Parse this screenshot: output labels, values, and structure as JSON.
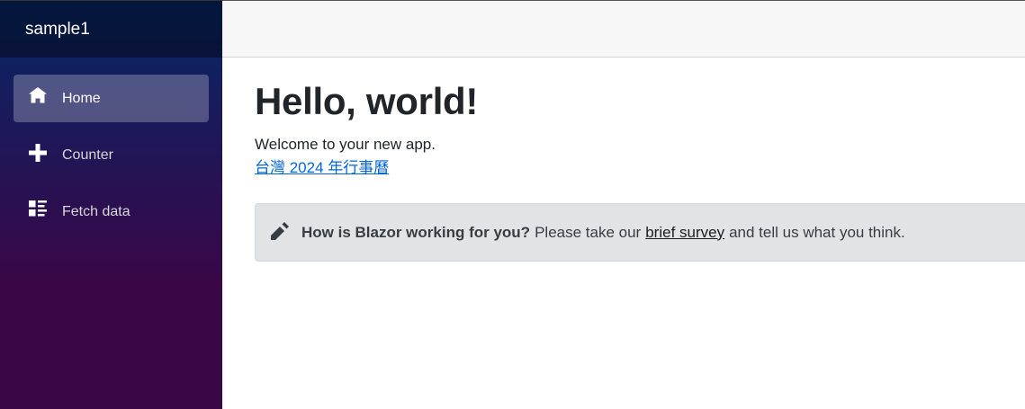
{
  "sidebar": {
    "brand": "sample1",
    "items": [
      {
        "label": "Home",
        "icon": "home-icon",
        "active": true
      },
      {
        "label": "Counter",
        "icon": "plus-icon",
        "active": false
      },
      {
        "label": "Fetch data",
        "icon": "list-rich-icon",
        "active": false
      }
    ]
  },
  "main": {
    "title": "Hello, world!",
    "welcome": "Welcome to your new app.",
    "link": "台灣 2024 年行事曆",
    "survey": {
      "bold": "How is Blazor working for you?",
      "before_link": "Please take our",
      "link": "brief survey",
      "after_link": "and tell us what you think."
    }
  },
  "colors": {
    "sidebar_top": "#052767",
    "sidebar_bottom": "#3a0647",
    "link": "#0366d6",
    "alert_bg": "#e2e3e5"
  }
}
